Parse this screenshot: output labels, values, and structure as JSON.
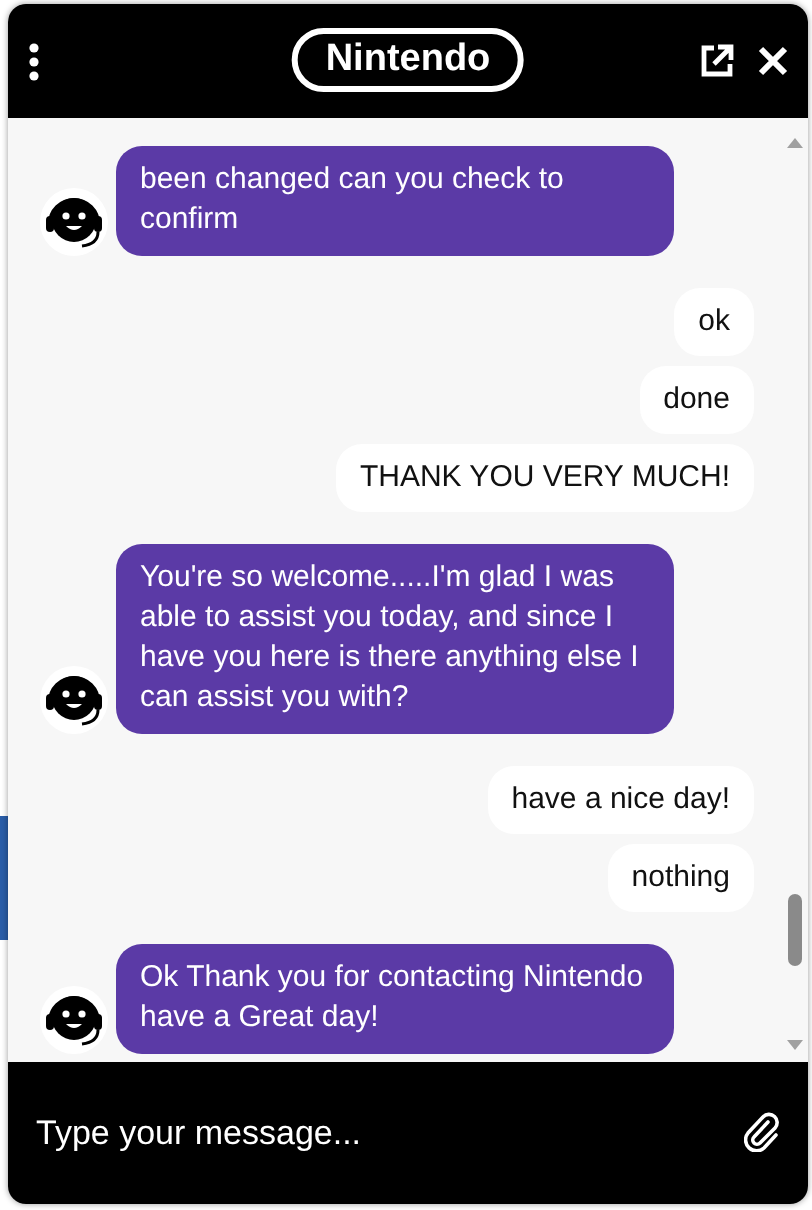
{
  "header": {
    "logo": "Nintendo"
  },
  "messages": [
    {
      "kind": "agent",
      "text": "been changed can you check to confirm"
    },
    {
      "kind": "user",
      "text": "ok"
    },
    {
      "kind": "user",
      "text": "done"
    },
    {
      "kind": "user",
      "text": "THANK YOU VERY MUCH!"
    },
    {
      "kind": "agent",
      "text": "You're so welcome.....I'm glad I was able to assist you today, and since I have you here is there anything else I can assist you with?"
    },
    {
      "kind": "user",
      "text": "have a nice day!"
    },
    {
      "kind": "user",
      "text": "nothing"
    },
    {
      "kind": "agent",
      "text": "Ok Thank you for contacting Nintendo have a Great day!"
    }
  ],
  "composer": {
    "placeholder": "Type your message..."
  }
}
